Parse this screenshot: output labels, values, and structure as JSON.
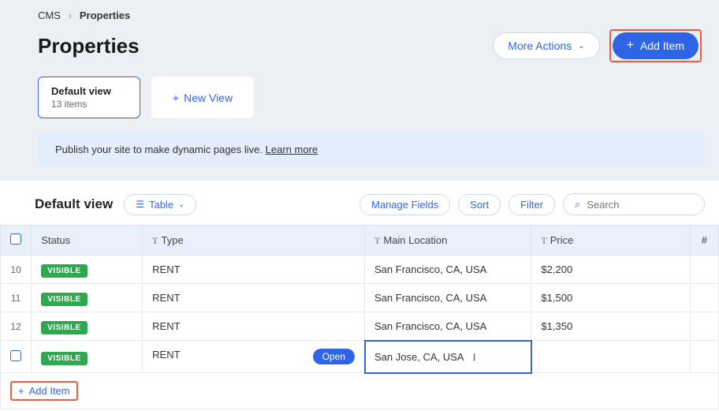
{
  "breadcrumb": {
    "root": "CMS",
    "page": "Properties"
  },
  "header": {
    "title": "Properties",
    "more_actions": "More Actions",
    "add_item": "Add Item"
  },
  "views": {
    "default": {
      "title": "Default view",
      "sub": "13 items"
    },
    "new": {
      "label": "New View"
    }
  },
  "banner": {
    "text": "Publish your site to make dynamic pages live.",
    "link": "Learn more"
  },
  "midbar": {
    "view_name": "Default view",
    "table_label": "Table",
    "manage_fields": "Manage Fields",
    "sort": "Sort",
    "filter": "Filter",
    "search_placeholder": "Search"
  },
  "columns": {
    "status": "Status",
    "type": "Type",
    "location": "Main Location",
    "price": "Price",
    "extra": "#"
  },
  "rows": [
    {
      "num": "10",
      "status": "VISIBLE",
      "type": "RENT",
      "location": "San Francisco, CA, USA",
      "price": "$2,200"
    },
    {
      "num": "11",
      "status": "VISIBLE",
      "type": "RENT",
      "location": "San Francisco, CA, USA",
      "price": "$1,500"
    },
    {
      "num": "12",
      "status": "VISIBLE",
      "type": "RENT",
      "location": "San Francisco, CA, USA",
      "price": "$1,350"
    }
  ],
  "editing_row": {
    "status": "VISIBLE",
    "type": "RENT",
    "open": "Open",
    "location": "San Jose, CA, USA",
    "price": ""
  },
  "footer": {
    "add_item": "Add Item"
  }
}
